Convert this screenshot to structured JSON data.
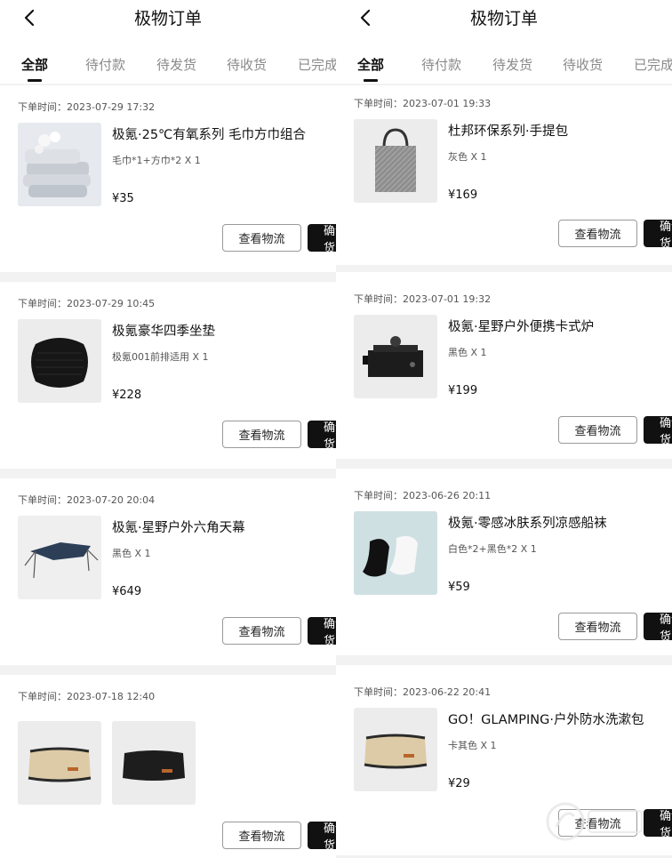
{
  "left": {
    "title": "极物订单",
    "tabs": [
      "全部",
      "待付款",
      "待发货",
      "待收货",
      "已完成"
    ],
    "orders": [
      {
        "time": "下单时间：2023-07-29 17:32",
        "name": "极氪·25℃有氧系列 毛巾方巾组合",
        "spec": "毛巾*1+方巾*2    X 1",
        "price": "¥35",
        "image": "towel-image"
      },
      {
        "time": "下单时间：2023-07-29 10:45",
        "name": "极氪豪华四季坐垫",
        "spec": "极氪001前排适用    X 1",
        "price": "¥228",
        "image": "seat-cushion-image"
      },
      {
        "time": "下单时间：2023-07-20 20:04",
        "name": "极氪·星野户外六角天幕",
        "spec": "黑色    X 1",
        "price": "¥649",
        "image": "canopy-image"
      },
      {
        "time": "下单时间：2023-07-18 12:40",
        "image": "toiletry-bag-khaki-image",
        "image2": "toiletry-bag-black-image"
      }
    ]
  },
  "right": {
    "title": "极物订单",
    "tabs": [
      "全部",
      "待付款",
      "待发货",
      "待收货",
      "已完成"
    ],
    "orders": [
      {
        "time": "下单时间：2023-07-01 19:33",
        "name": "杜邦环保系列·手提包",
        "spec": "灰色    X 1",
        "price": "¥169",
        "image": "tote-bag-image"
      },
      {
        "time": "下单时间：2023-07-01 19:32",
        "name": "极氪·星野户外便携卡式炉",
        "spec": "黑色    X 1",
        "price": "¥199",
        "image": "stove-image"
      },
      {
        "time": "下单时间：2023-06-26 20:11",
        "name": "极氪·零感冰肤系列凉感船袜",
        "spec": "白色*2+黑色*2    X 1",
        "price": "¥59",
        "image": "socks-image"
      },
      {
        "time": "下单时间：2023-06-22 20:41",
        "name": "GO！GLAMPING·户外防水洗漱包",
        "spec": "卡其色    X 1",
        "price": "¥29",
        "image": "toiletry-bag-khaki-image"
      }
    ]
  },
  "buttons": {
    "logistics": "查看物流",
    "confirm": "确认收货"
  },
  "icons": {
    "back": "chevron-left-icon"
  },
  "colors": {
    "accent": "#111111",
    "background": "#f2f2f2",
    "muted_text": "#8a8a8a"
  }
}
